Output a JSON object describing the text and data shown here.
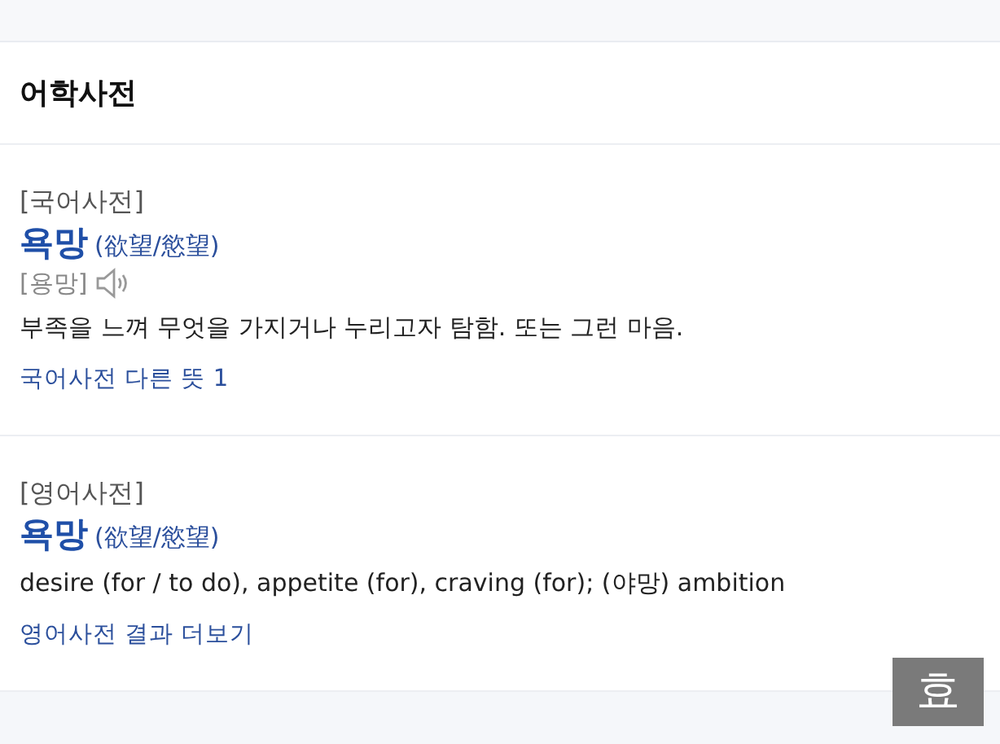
{
  "header": {
    "title": "어학사전"
  },
  "sections": [
    {
      "dictionary": "[국어사전]",
      "headword": "욕망",
      "hanja": "(欲望/慾望)",
      "pronunciation": "[용망]",
      "has_audio": true,
      "definition": "부족을 느껴 무엇을 가지거나 누리고자 탐함. 또는 그런 마음.",
      "link": "국어사전 다른 뜻 1"
    },
    {
      "dictionary": "[영어사전]",
      "headword": "욕망",
      "hanja": "(欲望/慾望)",
      "has_audio": false,
      "definition": "desire (for / to do), appetite (for), craving (for); (야망) ambition",
      "link": "영어사전 결과 더보기"
    }
  ],
  "floating_key": {
    "label": "효"
  }
}
